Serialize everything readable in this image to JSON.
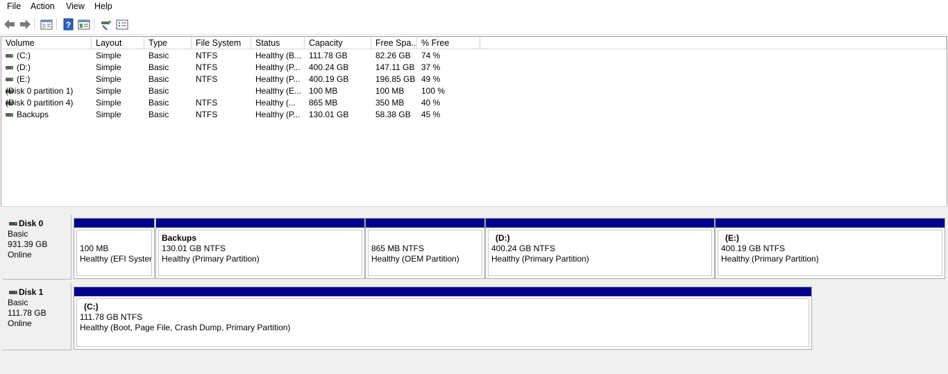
{
  "menu": {
    "file": "File",
    "action": "Action",
    "view": "View",
    "help": "Help"
  },
  "toolbar": {
    "icons": [
      "back-arrow-icon",
      "forward-arrow-icon",
      "properties-icon",
      "help-icon",
      "console-tree-icon",
      "connect-icon",
      "list-view-icon"
    ]
  },
  "volume_list": {
    "columns": [
      "Volume",
      "Layout",
      "Type",
      "File System",
      "Status",
      "Capacity",
      "Free Spa...",
      "% Free"
    ],
    "rows": [
      {
        "volume": "(C:)",
        "layout": "Simple",
        "type": "Basic",
        "fs": "NTFS",
        "status": "Healthy (B...",
        "capacity": "111.78 GB",
        "free": "82.26 GB",
        "pct": "74 %"
      },
      {
        "volume": "(D:)",
        "layout": "Simple",
        "type": "Basic",
        "fs": "NTFS",
        "status": "Healthy (P...",
        "capacity": "400.24 GB",
        "free": "147.11 GB",
        "pct": "37 %"
      },
      {
        "volume": "(E:)",
        "layout": "Simple",
        "type": "Basic",
        "fs": "NTFS",
        "status": "Healthy (P...",
        "capacity": "400.19 GB",
        "free": "196.85 GB",
        "pct": "49 %"
      },
      {
        "volume": "(Disk 0 partition 1)",
        "layout": "Simple",
        "type": "Basic",
        "fs": "",
        "status": "Healthy (E...",
        "capacity": "100 MB",
        "free": "100 MB",
        "pct": "100 %"
      },
      {
        "volume": "(Disk 0 partition 4)",
        "layout": "Simple",
        "type": "Basic",
        "fs": "NTFS",
        "status": "Healthy (...",
        "capacity": "865 MB",
        "free": "350 MB",
        "pct": "40 %"
      },
      {
        "volume": "Backups",
        "layout": "Simple",
        "type": "Basic",
        "fs": "NTFS",
        "status": "Healthy (P...",
        "capacity": "130.01 GB",
        "free": "58.38 GB",
        "pct": "45 %"
      }
    ]
  },
  "disks": [
    {
      "name": "Disk 0",
      "type": "Basic",
      "size": "931.39 GB",
      "state": "Online",
      "partitions": [
        {
          "name": "",
          "size": "100 MB",
          "status": "Healthy (EFI System"
        },
        {
          "name": "Backups",
          "size": "130.01 GB NTFS",
          "status": "Healthy (Primary Partition)"
        },
        {
          "name": "",
          "size": "865 MB NTFS",
          "status": "Healthy (OEM Partition)"
        },
        {
          "name": "(D:)",
          "size": "400.24 GB NTFS",
          "status": "Healthy (Primary Partition)"
        },
        {
          "name": "(E:)",
          "size": "400.19 GB NTFS",
          "status": "Healthy (Primary Partition)"
        }
      ]
    },
    {
      "name": "Disk 1",
      "type": "Basic",
      "size": "111.78 GB",
      "state": "Online",
      "partitions": [
        {
          "name": "(C:)",
          "size": "111.78 GB NTFS",
          "status": "Healthy (Boot, Page File, Crash Dump, Primary Partition)"
        }
      ]
    }
  ],
  "colors": {
    "partition_bar": "#00008b",
    "pane_bg": "#f0f0f0"
  }
}
